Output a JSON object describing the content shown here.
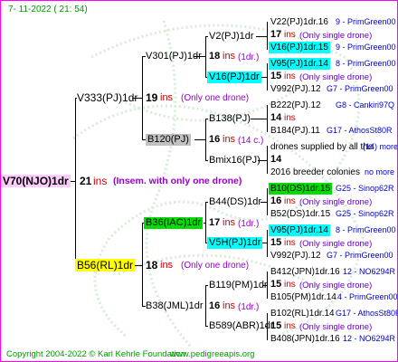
{
  "header": {
    "date": "7- 11-2022 ( 21: 54)"
  },
  "footer": {
    "copyright": "Copyright 2004-2022 © Karl Kehrle Foundation",
    "site": "www.pedigreeapis.org"
  },
  "colors": {
    "border": "#ff00ff",
    "pink_bg": "#ffccff",
    "cyan_bg": "#00ffff",
    "gray_bg": "#c0c0c0",
    "green_bg": "#00dd00",
    "yellow_bg": "#ffff00",
    "red": "#cc0000",
    "blue": "#0000cc",
    "purple": "#9900cc"
  },
  "root": {
    "id": "V70(NJO)1dr",
    "inbreeding": "21",
    "unit": "ins",
    "note": "(Insem. with only one drone)"
  },
  "g1": [
    {
      "id": "V333(PJ)1dr",
      "inbreeding": "19",
      "unit": "ins",
      "note": "(Only one drone)"
    },
    {
      "id": "B56(RL)1dr",
      "inbreeding": "18",
      "unit": "ins",
      "note": "(Only one drone)"
    }
  ],
  "g2": [
    {
      "id": "V301(PJ)1dr",
      "inbreeding": "18",
      "unit": "ins",
      "note": "(1dr.)"
    },
    {
      "id": "B120(PJ)",
      "inbreeding": "16",
      "unit": "ins",
      "note": "(14 c.)"
    },
    {
      "id": "B36(IAC)1dr",
      "inbreeding": "17",
      "unit": "ins",
      "note": "(1dr.)"
    },
    {
      "id": "B38(JML)1dr",
      "inbreeding": "16",
      "unit": "ins",
      "note": "(1dr.)"
    }
  ],
  "g3": [
    {
      "id": "V2(PJ)1dr"
    },
    {
      "id": "V16(PJ)1dr"
    },
    {
      "id": "B138(PJ)"
    },
    {
      "id": "Bmix16(PJ)"
    },
    {
      "id": "B44(DS)1dr"
    },
    {
      "id": "V5H(PJ)1dr"
    },
    {
      "id": "B119(PM)1dr"
    },
    {
      "id": "B589(ABR)1dr"
    }
  ],
  "g4": [
    {
      "line1": "V22(PJ)1dr.16",
      "line1_suffix": "9 - PrimGreen00",
      "line2_num": "17",
      "line2_unit": "ins",
      "line2_note": "(Only single drone)",
      "line3": "V16(PJ)1dr.15",
      "line3_suffix": "9 - PrimGreen00"
    },
    {
      "line1": "V95(PJ)1dr.14",
      "line1_suffix": "8 - PrimGreen00",
      "line2_num": "15",
      "line2_unit": "ins",
      "line2_note": "(Only single drone)",
      "line3": "V992(PJ).12",
      "line3_suffix": "G7 - PrimGreen00"
    },
    {
      "line1": "B222(PJ).12",
      "line1_suffix": "G8 - Cankiri97Q",
      "line2_num": "14",
      "line2_unit": "ins",
      "line2_note": "",
      "line3": "B184(PJ).11",
      "line3_suffix": "G17 - AthosSt80R"
    },
    {
      "line1": "drones supplied by all the",
      "line1_suffix": "(14) more",
      "line2_num": "14",
      "line2_unit": "",
      "line2_note": "",
      "line3": "2016 breeder colonies",
      "line3_suffix": "no more"
    },
    {
      "line1": "B10(DS)1dr.15",
      "line1_suffix": "G25 - Sinop62R",
      "line2_num": "16",
      "line2_unit": "ins",
      "line2_note": "(Only single drone)",
      "line3": "B52(DS)1dr.15",
      "line3_suffix": "G25 - Sinop62R"
    },
    {
      "line1": "V95(PJ)1dr.14",
      "line1_suffix": "8 - PrimGreen00",
      "line2_num": "15",
      "line2_unit": "ins",
      "line2_note": "(Only single drone)",
      "line3": "V992(PJ).12",
      "line3_suffix": "G7 - PrimGreen00"
    },
    {
      "line1": "B412(JPN)1dr.16",
      "line1_suffix": "12 - NO6294R",
      "line2_num": "15",
      "line2_unit": "ins",
      "line2_note": "(Only single drone)",
      "line3": "B105(PM)1dr.14",
      "line3_suffix": "4 - PrimGreen00"
    },
    {
      "line1": "B102(RL)1dr.14",
      "line1_suffix": "G17 - AthosSt80R",
      "line2_num": "15",
      "line2_unit": "ins",
      "line2_note": "(Only single drone)",
      "line3": "B408(JPN)1dr.16",
      "line3_suffix": "12 - NO6294R"
    }
  ]
}
